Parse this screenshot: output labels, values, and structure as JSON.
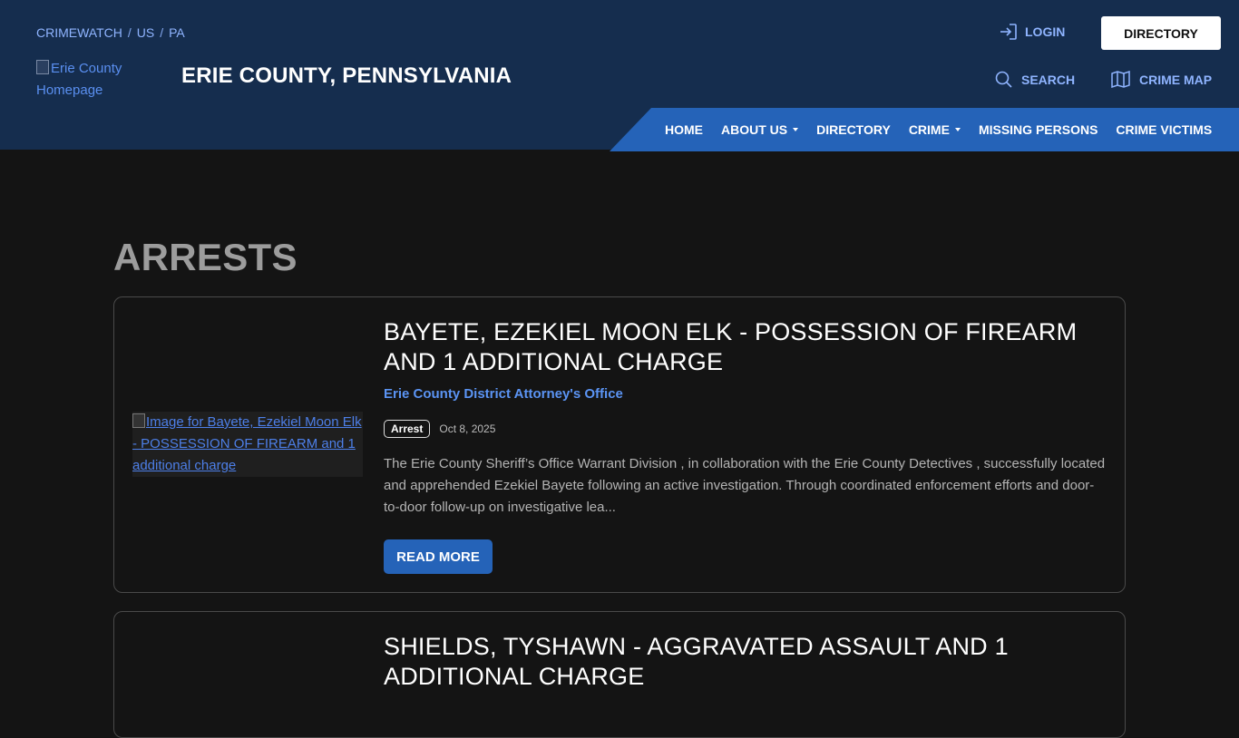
{
  "breadcrumb": {
    "items": [
      "CRIMEWATCH",
      "US",
      "PA"
    ],
    "separator": "/"
  },
  "header": {
    "logo_alt": "Erie County Homepage",
    "site_title": "ERIE COUNTY, PENNSYLVANIA",
    "login_label": "LOGIN",
    "directory_button_label": "DIRECTORY",
    "search_label": "SEARCH",
    "crime_map_label": "CRIME MAP"
  },
  "nav": {
    "items": [
      {
        "label": "HOME",
        "dropdown": false
      },
      {
        "label": "ABOUT US",
        "dropdown": true
      },
      {
        "label": "DIRECTORY",
        "dropdown": false
      },
      {
        "label": "CRIME",
        "dropdown": true
      },
      {
        "label": "MISSING PERSONS",
        "dropdown": false
      },
      {
        "label": "CRIME VICTIMS",
        "dropdown": false
      }
    ]
  },
  "main": {
    "heading": "ARRESTS",
    "cards": [
      {
        "image_alt": "Image for Bayete, Ezekiel Moon Elk - POSSESSION OF FIREARM and 1 additional charge",
        "title": "BAYETE, EZEKIEL MOON ELK - POSSESSION OF FIREARM AND 1 ADDITIONAL CHARGE",
        "agency": "Erie County District Attorney's Office",
        "badge": "Arrest",
        "date": "Oct 8, 2025",
        "excerpt": "The Erie County Sheriff’s Office Warrant Division , in collaboration with the Erie County Detectives , successfully located and apprehended Ezekiel Bayete following an active investigation. Through coordinated enforcement efforts and door-to-door follow-up on investigative lea...",
        "read_more_label": "READ MORE"
      },
      {
        "title": "SHIELDS, TYSHAWN - AGGRAVATED ASSAULT AND 1 ADDITIONAL CHARGE"
      }
    ]
  },
  "colors": {
    "header_bg": "#152d4e",
    "nav_bg": "#2563b8",
    "link": "#8fb4ff",
    "page_bg": "#141414"
  },
  "icons": {
    "login": "login-arrow-icon",
    "search": "search-icon",
    "crime_map": "map-icon",
    "dropdown": "caret-down-icon"
  }
}
